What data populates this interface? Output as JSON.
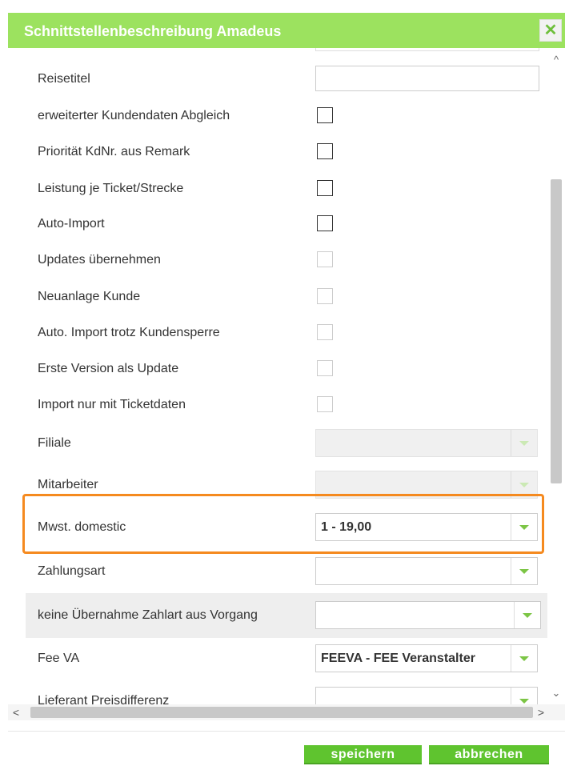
{
  "dialog": {
    "title": "Schnittstellenbeschreibung Amadeus",
    "close_symbol": "✕",
    "colors": {
      "titlebar": "#9ce25f",
      "highlight": "#f58a1f",
      "button": "#5fc42f"
    }
  },
  "fields": {
    "reisetitel": {
      "label": "Reisetitel",
      "value": ""
    },
    "erweiterter_abgleich": {
      "label": "erweiterter Kundendaten Abgleich",
      "checked": false
    },
    "prioritaet_kdnr": {
      "label": "Priorität KdNr. aus Remark",
      "checked": false
    },
    "leistung_je_ticket": {
      "label": "Leistung je Ticket/Strecke",
      "checked": false
    },
    "auto_import": {
      "label": "Auto-Import",
      "checked": false
    },
    "updates_uebernehmen": {
      "label": "Updates übernehmen",
      "checked": false,
      "disabled": true
    },
    "neuanlage_kunde": {
      "label": "Neuanlage Kunde",
      "checked": false,
      "disabled": true
    },
    "auto_import_trotz_sperre": {
      "label": "Auto. Import trotz Kundensperre",
      "checked": false,
      "disabled": true
    },
    "erste_version_update": {
      "label": "Erste Version als Update",
      "checked": false,
      "disabled": true
    },
    "import_nur_ticketdaten": {
      "label": "Import nur mit Ticketdaten",
      "checked": false,
      "disabled": true
    },
    "filiale": {
      "label": "Filiale",
      "value": "",
      "disabled": true
    },
    "mitarbeiter": {
      "label": "Mitarbeiter",
      "value": "",
      "disabled": true
    },
    "mwst_domestic": {
      "label": "Mwst. domestic",
      "value": "1 - 19,00"
    },
    "zahlungsart": {
      "label": "Zahlungsart",
      "value": ""
    },
    "keine_uebernahme_zahlart": {
      "label": "keine Übernahme Zahlart aus Vorgang",
      "value": ""
    },
    "fee_va": {
      "label": "Fee VA",
      "value": "FEEVA - FEE Veranstalter"
    },
    "lieferant_preisdifferenz": {
      "label": "Lieferant Preisdifferenz",
      "value": ""
    }
  },
  "scrollbar": {
    "up": "^",
    "down": "⌄",
    "left": "<",
    "right": ">"
  },
  "footer": {
    "save_label": "speichern",
    "cancel_label": "abbrechen"
  }
}
